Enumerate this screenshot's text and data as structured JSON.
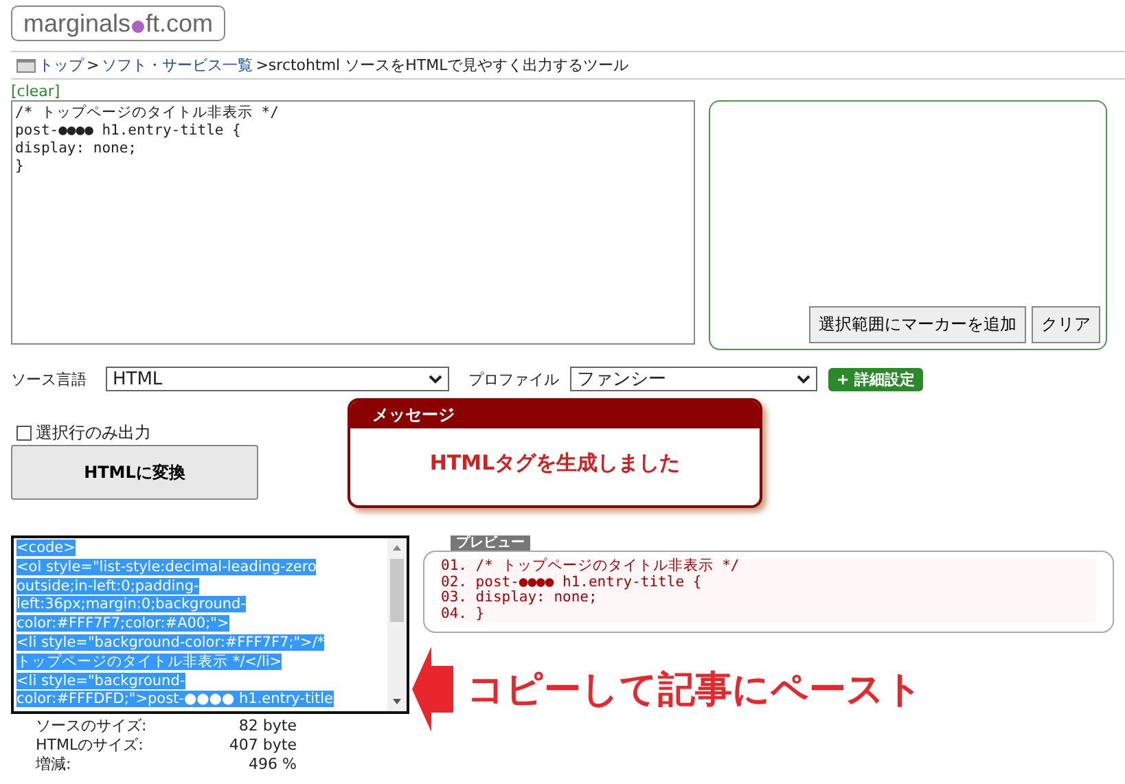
{
  "logo": {
    "before": "marginals",
    "after": "ft.com"
  },
  "breadcrumb": [
    {
      "label": "トップ",
      "link": true
    },
    {
      "label": ">",
      "link": false
    },
    {
      "label": "ソフト・サービス一覧",
      "link": true
    },
    {
      "label": ">srctohtml ソースをHTMLで見やすく出力するツール",
      "link": false
    }
  ],
  "clear_link": "[clear]",
  "source_lines": [
    "/* トップページのタイトル非表示 */",
    "post-●●●● h1.entry-title {",
    "display: none;",
    "}"
  ],
  "marker_buttons": [
    "選択範囲にマーカーを追加",
    "クリア"
  ],
  "source_language": {
    "label": "ソース言語",
    "value": "HTML"
  },
  "profile": {
    "label": "プロファイル",
    "value": "ファンシー"
  },
  "advanced_button": "+ 詳細設定",
  "selected_only": {
    "label": "選択行のみ出力",
    "checked": false
  },
  "convert_button": "HTMLに変換",
  "message": {
    "title": "メッセージ",
    "text": "HTMLタグを生成しました"
  },
  "output_lines": [
    "<code>",
    "<ol style=\"list-style:decimal-leading-zero",
    "outside;in-left:0;padding-",
    "left:36px;margin:0;background-",
    "color:#FFF7F7;color:#A00;\">",
    "<li style=\"background-color:#FFF7F7;\">/*",
    "トップページのタイトル非表示 */</li>",
    "<li style=\"background-",
    "color:#FFFDFD;\">post-●●●● h1.entry-title"
  ],
  "preview": {
    "label": "プレビュー",
    "lines": [
      {
        "number": "01.",
        "text": "/* トップページのタイトル非表示 */"
      },
      {
        "number": "02.",
        "text": "post-●●●● h1.entry-title {"
      },
      {
        "number": "03.",
        "text": "display: none;"
      },
      {
        "number": "04.",
        "text": "}"
      }
    ]
  },
  "callout": "コピーして記事にペースト",
  "stats": [
    {
      "label": "ソースのサイズ:",
      "value": "82 byte"
    },
    {
      "label": "HTMLのサイズ:",
      "value": "407 byte"
    },
    {
      "label": "増減:",
      "value": "496 %"
    }
  ]
}
